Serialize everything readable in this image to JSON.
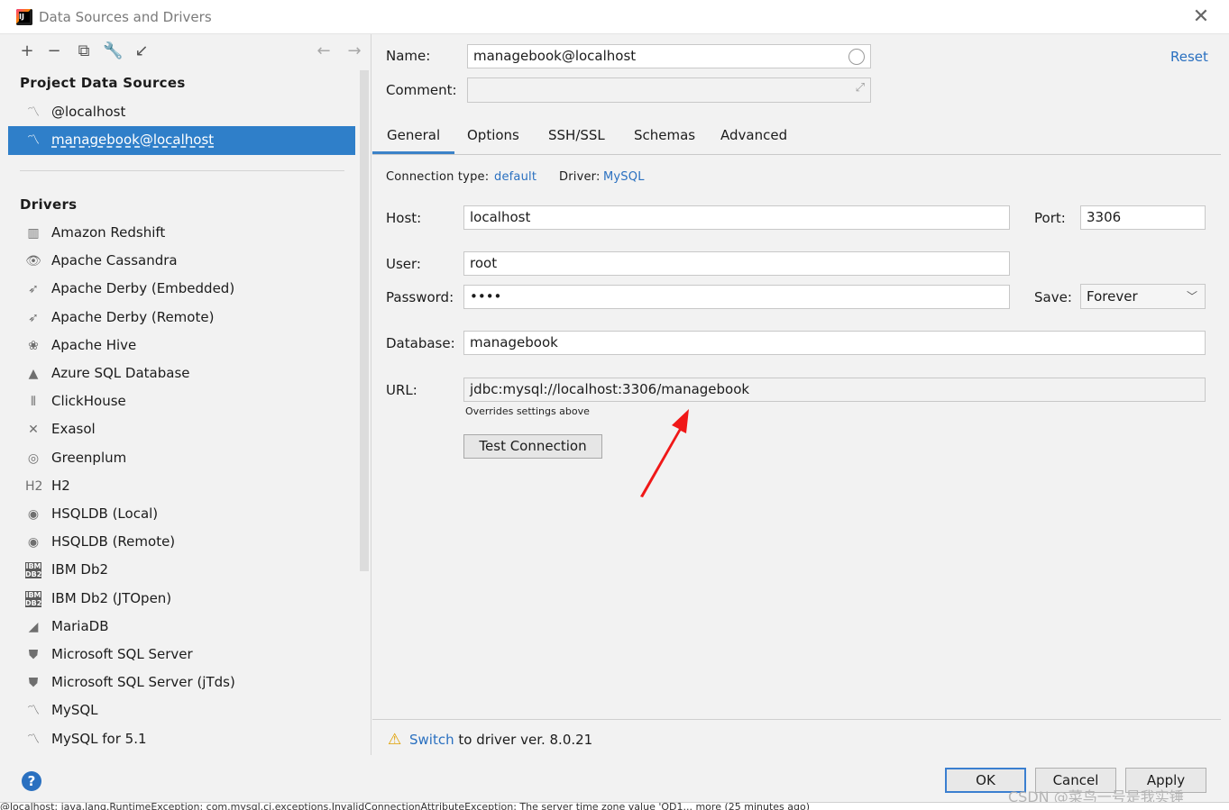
{
  "window": {
    "title": "Data Sources and Drivers",
    "close_glyph": "✕"
  },
  "left": {
    "toolbar": [
      "+",
      "−",
      "⧉",
      "🔧",
      "↙",
      "←",
      "→"
    ],
    "project_title": "Project Data Sources",
    "data_sources": [
      {
        "label": "@localhost",
        "icon": "mysql-icon"
      },
      {
        "label": "managebook@localhost",
        "icon": "mysql-icon",
        "selected": true
      }
    ],
    "drivers_title": "Drivers",
    "drivers": [
      {
        "label": "Amazon Redshift",
        "icon": "redshift-icon",
        "glyph": "▥"
      },
      {
        "label": "Apache Cassandra",
        "icon": "cassandra-icon",
        "glyph": "👁"
      },
      {
        "label": "Apache Derby (Embedded)",
        "icon": "derby-icon",
        "glyph": "➶"
      },
      {
        "label": "Apache Derby (Remote)",
        "icon": "derby-icon",
        "glyph": "➶"
      },
      {
        "label": "Apache Hive",
        "icon": "hive-icon",
        "glyph": "❀"
      },
      {
        "label": "Azure SQL Database",
        "icon": "azure-icon",
        "glyph": "▲"
      },
      {
        "label": "ClickHouse",
        "icon": "clickhouse-icon",
        "glyph": "⦀"
      },
      {
        "label": "Exasol",
        "icon": "exasol-icon",
        "glyph": "✕"
      },
      {
        "label": "Greenplum",
        "icon": "greenplum-icon",
        "glyph": "◎"
      },
      {
        "label": "H2",
        "icon": "h2-icon",
        "glyph": "H2"
      },
      {
        "label": "HSQLDB (Local)",
        "icon": "hsqldb-icon",
        "glyph": "◉"
      },
      {
        "label": "HSQLDB (Remote)",
        "icon": "hsqldb-icon",
        "glyph": "◉"
      },
      {
        "label": "IBM Db2",
        "icon": "db2-icon",
        "glyph": "IBM DB2"
      },
      {
        "label": "IBM Db2 (JTOpen)",
        "icon": "db2-icon",
        "glyph": "IBM DB2"
      },
      {
        "label": "MariaDB",
        "icon": "mariadb-icon",
        "glyph": "◢"
      },
      {
        "label": "Microsoft SQL Server",
        "icon": "sqlserver-icon",
        "glyph": "⛊"
      },
      {
        "label": "Microsoft SQL Server (jTds)",
        "icon": "sqlserver-icon",
        "glyph": "⛊"
      },
      {
        "label": "MySQL",
        "icon": "mysql-icon",
        "glyph": "〽"
      },
      {
        "label": "MySQL for 5.1",
        "icon": "mysql-icon",
        "glyph": "〽"
      }
    ]
  },
  "form": {
    "name_label": "Name:",
    "name_value": "managebook@localhost",
    "comment_label": "Comment:",
    "comment_value": "",
    "reset": "Reset",
    "tabs": [
      "General",
      "Options",
      "SSH/SSL",
      "Schemas",
      "Advanced"
    ],
    "active_tab": "General",
    "connection_type_label": "Connection type:",
    "connection_type_value": "default",
    "driver_label": "Driver:",
    "driver_value": "MySQL",
    "host_label": "Host:",
    "host_value": "localhost",
    "port_label": "Port:",
    "port_value": "3306",
    "user_label": "User:",
    "user_value": "root",
    "password_label": "Password:",
    "password_value": "••••",
    "save_label": "Save:",
    "save_value": "Forever",
    "database_label": "Database:",
    "database_value": "managebook",
    "url_label": "URL:",
    "url_value": "jdbc:mysql://localhost:3306/managebook",
    "url_note": "Overrides settings above",
    "test_button": "Test Connection",
    "warning_link": "Switch",
    "warning_text": " to driver ver. 8.0.21"
  },
  "footer": {
    "help": "?",
    "ok": "OK",
    "cancel": "Cancel",
    "apply": "Apply",
    "watermark": "CSDN @菜鸟一号是我实锤"
  },
  "statusbar": "@localhost: java.lang.RuntimeException: com.mysql.cj.exceptions.InvalidConnectionAttributeException: The server time zone value 'ÖD1... more (25 minutes ago)",
  "colors": {
    "accent": "#2f7fc9",
    "link": "#2a70c0",
    "warning": "#e0a000",
    "arrow": "#f01818"
  }
}
